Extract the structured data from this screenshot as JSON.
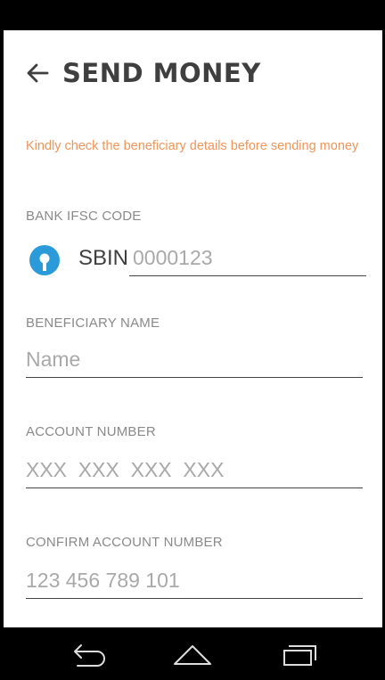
{
  "header": {
    "title": "SEND MONEY",
    "back_icon": "arrow-left-icon"
  },
  "notice": "Kindly check the beneficiary details before sending money",
  "fields": {
    "ifsc": {
      "label": "BANK IFSC CODE",
      "prefix": "SBIN",
      "placeholder": "0000123",
      "bank_icon": "sbi-logo-icon"
    },
    "beneficiary_name": {
      "label": "BENEFICIARY NAME",
      "placeholder": "Name"
    },
    "account_number": {
      "label": "ACCOUNT NUMBER",
      "placeholder": "XXX  XXX  XXX  XXX"
    },
    "confirm_account_number": {
      "label": "CONFIRM ACCOUNT NUMBER",
      "placeholder": "123 456 789 101"
    }
  },
  "navigation": {
    "back_icon": "nav-back-icon",
    "home_icon": "nav-home-icon",
    "recents_icon": "nav-recents-icon"
  },
  "colors": {
    "notice": "#f1955a",
    "bank_logo": "#2a9bd8",
    "title": "#3f3f3f",
    "label": "#8a8a8a",
    "placeholder": "#a9a9a9"
  }
}
